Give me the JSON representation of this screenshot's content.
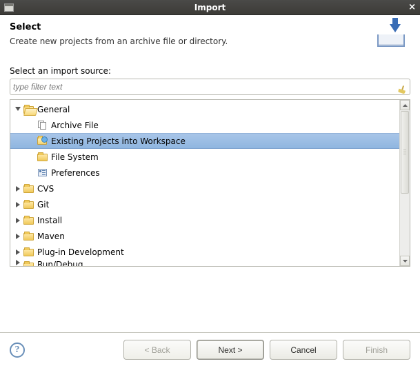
{
  "window": {
    "title": "Import"
  },
  "header": {
    "title": "Select",
    "subtitle": "Create new projects from an archive file or directory."
  },
  "main": {
    "label": "Select an import source:",
    "filter_placeholder": "type filter text"
  },
  "tree": {
    "general": {
      "label": "General",
      "children": {
        "archive": "Archive File",
        "existing": "Existing Projects into Workspace",
        "filesystem": "File System",
        "preferences": "Preferences"
      }
    },
    "cvs": "CVS",
    "git": "Git",
    "install": "Install",
    "maven": "Maven",
    "plugin": "Plug-in Development",
    "rundebug": "Run/Debug"
  },
  "buttons": {
    "back": "< Back",
    "next": "Next >",
    "cancel": "Cancel",
    "finish": "Finish"
  }
}
